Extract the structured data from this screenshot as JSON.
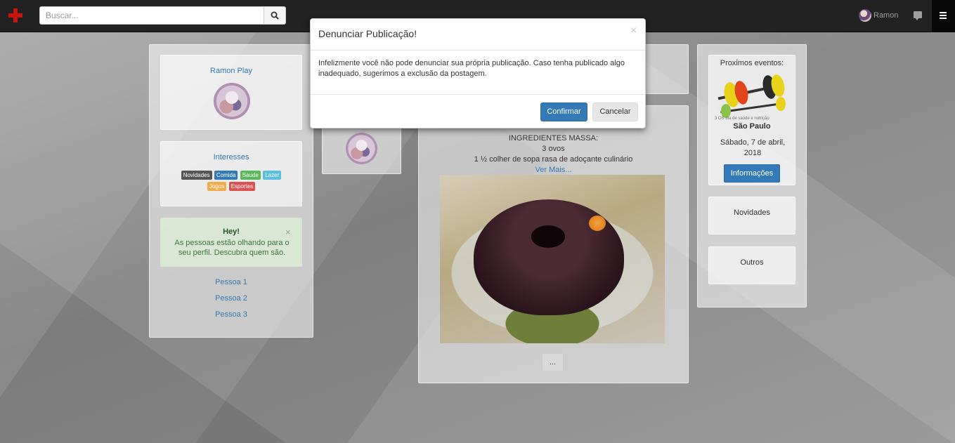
{
  "navbar": {
    "search_placeholder": "Buscar...",
    "user_name": "Ramon"
  },
  "profile": {
    "name": "Ramon Play"
  },
  "interests": {
    "title": "Interesses",
    "tags": [
      {
        "label": "Novidades",
        "color": "#555555"
      },
      {
        "label": "Comida",
        "color": "#337ab7"
      },
      {
        "label": "Saude",
        "color": "#5cb85c"
      },
      {
        "label": "Lazer",
        "color": "#5bc0de"
      },
      {
        "label": "Jogos",
        "color": "#f0ad4e"
      },
      {
        "label": "Esportes",
        "color": "#d9534f"
      }
    ]
  },
  "alert": {
    "title": "Hey!",
    "text": "As pessoas estão olhando para o seu perfil. Descubra quem são.",
    "close": "×"
  },
  "people": [
    "Pessoa 1",
    "Pessoa 2",
    "Pessoa 3"
  ],
  "post": {
    "lines": [
      "INGREDIENTES MASSA:",
      "3 ovos",
      "1 ½ colher de sopa rasa de adoçante culinário"
    ],
    "more_link": "Ver Mais...",
    "more_button": "..."
  },
  "events": {
    "title": "Proximos eventos:",
    "image_caption": "3 OS dia de saúde e nutrição",
    "city": "São Paulo",
    "date": "Sábado, 7 de abril, 2018",
    "info_button": "Informações"
  },
  "side_boxes": [
    "Novidades",
    "Outros"
  ],
  "modal": {
    "title": "Denunciar Publicação!",
    "close": "×",
    "body": "Infelizmente você não pode denunciar sua própria publicação. Caso tenha publicado algo inadequado, sugerimos a exclusão da postagem.",
    "confirm": "Confirmar",
    "cancel": "Cancelar"
  }
}
